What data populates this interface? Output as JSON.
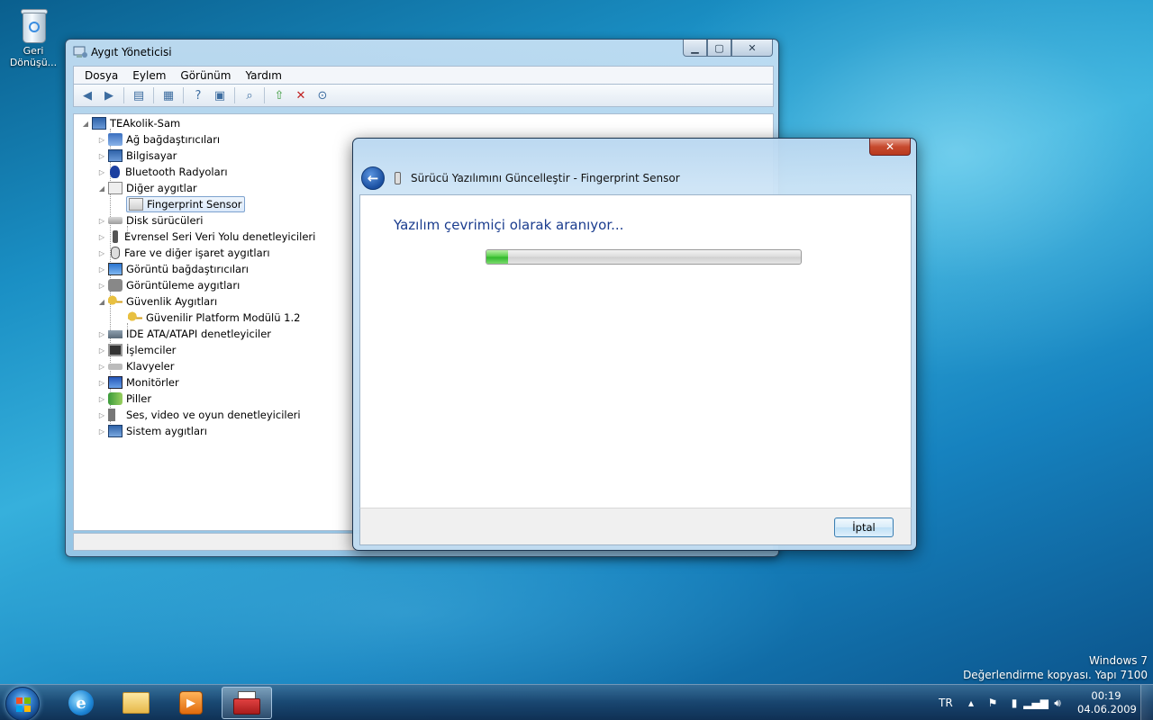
{
  "desktop": {
    "recycle_bin_label": "Geri Dönüşü..."
  },
  "device_manager": {
    "title": "Aygıt Yöneticisi",
    "menu": [
      "Dosya",
      "Eylem",
      "Görünüm",
      "Yardım"
    ],
    "root": "TEAkolik-Sam",
    "tree": [
      {
        "label": "Ağ bağdaştırıcıları",
        "expanded": false,
        "icon": "network-adapter-icon"
      },
      {
        "label": "Bilgisayar",
        "expanded": false,
        "icon": "computer-icon"
      },
      {
        "label": "Bluetooth Radyoları",
        "expanded": false,
        "icon": "bluetooth-icon"
      },
      {
        "label": "Diğer aygıtlar",
        "expanded": true,
        "icon": "unknown-device-icon"
      },
      {
        "label": "Fingerprint Sensor",
        "child": true,
        "selected": true,
        "icon": "warning-device-icon"
      },
      {
        "label": "Disk sürücüleri",
        "expanded": false,
        "icon": "disk-drive-icon"
      },
      {
        "label": "Evrensel Seri Veri Yolu denetleyicileri",
        "expanded": false,
        "icon": "usb-icon"
      },
      {
        "label": "Fare ve diğer işaret aygıtları",
        "expanded": false,
        "icon": "mouse-icon"
      },
      {
        "label": "Görüntü bağdaştırıcıları",
        "expanded": false,
        "icon": "display-adapter-icon"
      },
      {
        "label": "Görüntüleme aygıtları",
        "expanded": false,
        "icon": "camera-icon"
      },
      {
        "label": "Güvenlik Aygıtları",
        "expanded": true,
        "icon": "security-key-icon"
      },
      {
        "label": "Güvenilir Platform Modülü 1.2",
        "child": true,
        "icon": "security-key-icon"
      },
      {
        "label": "IDE ATA/ATAPI denetleyiciler",
        "expanded": false,
        "icon": "ide-controller-icon"
      },
      {
        "label": "İşlemciler",
        "expanded": false,
        "icon": "processor-icon"
      },
      {
        "label": "Klavyeler",
        "expanded": false,
        "icon": "keyboard-icon"
      },
      {
        "label": "Monitörler",
        "expanded": false,
        "icon": "monitor-icon"
      },
      {
        "label": "Piller",
        "expanded": false,
        "icon": "battery-icon"
      },
      {
        "label": "Ses, video ve oyun denetleyicileri",
        "expanded": false,
        "icon": "sound-icon"
      },
      {
        "label": "Sistem aygıtları",
        "expanded": false,
        "icon": "system-devices-icon"
      }
    ]
  },
  "wizard": {
    "title": "Sürücü Yazılımını Güncelleştir - Fingerprint Sensor",
    "heading": "Yazılım çevrimiçi olarak aranıyor...",
    "progress_fraction": 0.07,
    "cancel_label": "İptal",
    "close_glyph": "✕"
  },
  "watermark": {
    "line1": "Windows 7",
    "line2": "Değerlendirme kopyası. Yapı 7100"
  },
  "taskbar": {
    "language": "TR",
    "time": "00:19",
    "date": "04.06.2009",
    "pinned": [
      "internet-explorer-icon",
      "windows-explorer-icon",
      "media-player-icon",
      "device-manager-icon"
    ]
  }
}
